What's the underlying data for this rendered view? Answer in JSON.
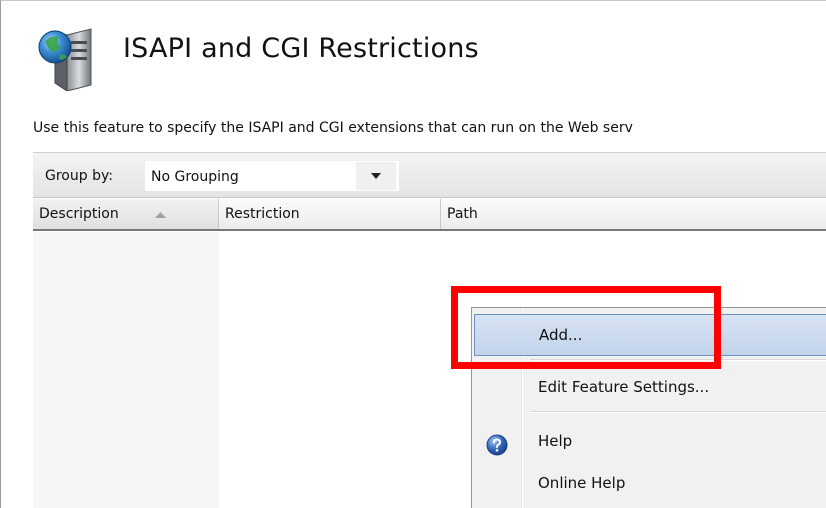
{
  "header": {
    "title": "ISAPI and CGI Restrictions",
    "description": "Use this feature to specify the ISAPI and CGI extensions that can run on the Web serv"
  },
  "toolbar": {
    "group_by_label": "Group by:",
    "group_by_value": "No Grouping"
  },
  "columns": [
    {
      "label": "Description",
      "sorted": "ascending"
    },
    {
      "label": "Restriction"
    },
    {
      "label": "Path"
    }
  ],
  "context_menu": {
    "items": [
      {
        "label": "Add...",
        "highlighted": true
      },
      {
        "label": "Edit Feature Settings..."
      },
      {
        "label": "Help",
        "icon": "help-icon"
      },
      {
        "label": "Online Help"
      }
    ]
  },
  "icons": {
    "feature": "server-globe-icon",
    "sort": "sort-ascending-icon",
    "dropdown": "chevron-down-icon",
    "help": "help-icon"
  },
  "colors": {
    "highlight_annotation": "#ff0000",
    "menu_selection": "#c8d8ee",
    "help_icon_blue": "#2f62b4"
  }
}
